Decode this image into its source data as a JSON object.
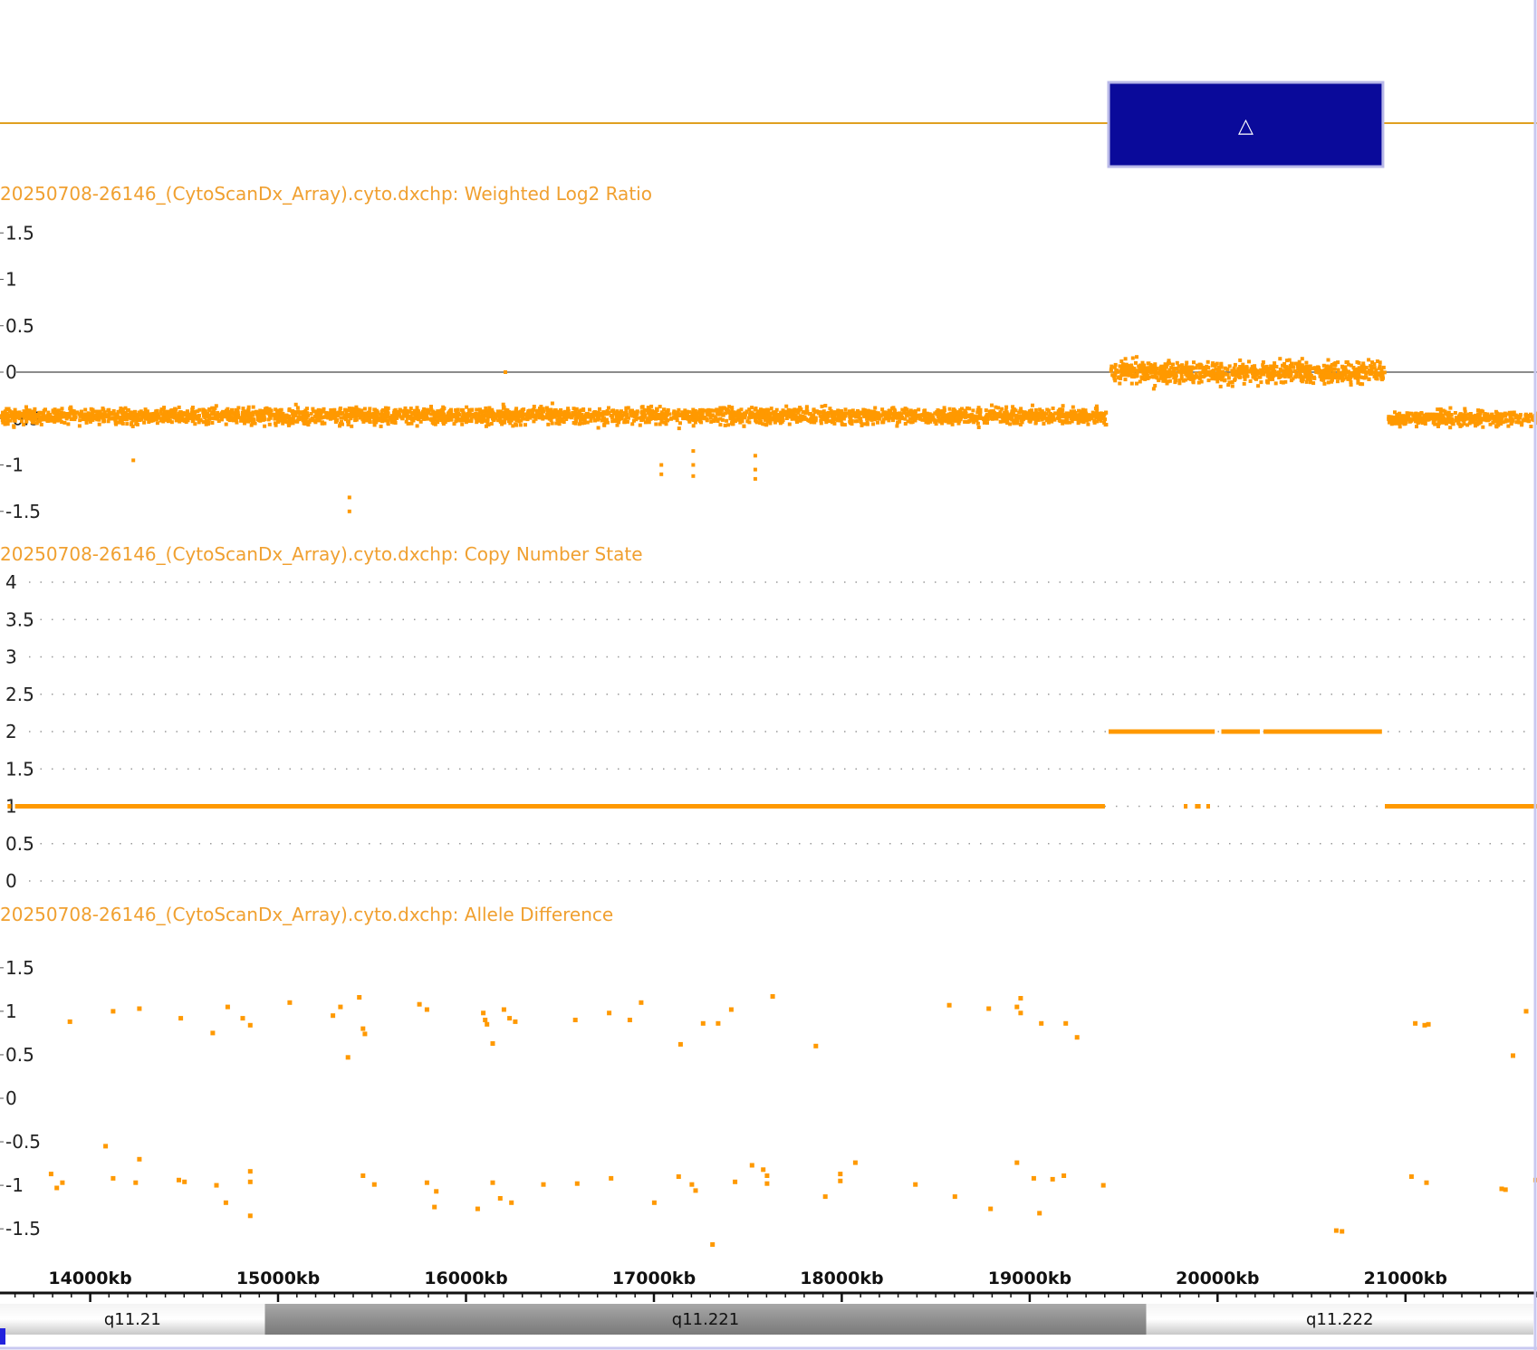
{
  "colors": {
    "data": "#ff9900",
    "title": "#f0a030",
    "segment_fill": "#0a0a9a",
    "segment_border": "#b8b8e8",
    "segment_line": "#e0a020",
    "frame": "#c8c8f0",
    "grid": "#9a9a9a",
    "zero_line": "#666666"
  },
  "segment_track": {
    "icon": "triangle-up-icon",
    "glyph": "△",
    "segment_kb": [
      19420,
      20880
    ]
  },
  "x_axis": {
    "range_kb": [
      13520,
      21700
    ],
    "tick_labels": [
      "14000kb",
      "15000kb",
      "16000kb",
      "17000kb",
      "18000kb",
      "19000kb",
      "20000kb",
      "21000kb"
    ],
    "tick_values_kb": [
      14000,
      15000,
      16000,
      17000,
      18000,
      19000,
      20000,
      21000
    ]
  },
  "cytobands": [
    {
      "name": "q11.21",
      "start_kb": 13520,
      "end_kb": 14930,
      "shade": "light"
    },
    {
      "name": "q11.221",
      "start_kb": 14930,
      "end_kb": 19620,
      "shade": "dark"
    },
    {
      "name": "q11.222",
      "start_kb": 19620,
      "end_kb": 21700,
      "shade": "light"
    }
  ],
  "chart_data": [
    {
      "type": "scatter",
      "title": "20250708-26146_(CytoScanDx_Array).cyto.dxchp: Weighted Log2 Ratio",
      "ylim": [
        -1.6,
        1.6
      ],
      "yticks": [
        "1.5",
        "1",
        "0.5",
        "0",
        "-0.5",
        "-1",
        "-1.5"
      ],
      "ytick_values": [
        1.5,
        1,
        0.5,
        0,
        -0.5,
        -1,
        -1.5
      ],
      "zero_line": true,
      "regions": [
        {
          "x_kb": [
            13520,
            19400
          ],
          "mean": -0.47,
          "spread": 0.09
        },
        {
          "x_kb": [
            19420,
            20880
          ],
          "mean": 0.0,
          "spread": 0.12
        },
        {
          "x_kb": [
            20900,
            21700
          ],
          "mean": -0.5,
          "spread": 0.08
        }
      ],
      "outliers": [
        {
          "x": 15370,
          "y": -1.35
        },
        {
          "x": 15370,
          "y": -1.5
        },
        {
          "x": 17030,
          "y": -1.0
        },
        {
          "x": 17030,
          "y": -1.1
        },
        {
          "x": 17200,
          "y": -0.85
        },
        {
          "x": 17200,
          "y": -1.0
        },
        {
          "x": 17200,
          "y": -1.12
        },
        {
          "x": 17530,
          "y": -0.9
        },
        {
          "x": 17530,
          "y": -1.05
        },
        {
          "x": 17530,
          "y": -1.15
        },
        {
          "x": 16200,
          "y": 0.0
        },
        {
          "x": 14220,
          "y": -0.95
        }
      ]
    },
    {
      "type": "line",
      "title": "20250708-26146_(CytoScanDx_Array).cyto.dxchp: Copy Number State",
      "ylim": [
        0,
        4
      ],
      "yticks": [
        "4",
        "3.5",
        "3",
        "2.5",
        "2",
        "1.5",
        "1",
        "0.5",
        "0"
      ],
      "ytick_values": [
        4,
        3.5,
        3,
        2.5,
        2,
        1.5,
        1,
        0.5,
        0
      ],
      "grid": "dotted",
      "segments": [
        {
          "x_kb": [
            13560,
            13580
          ],
          "state": 1
        },
        {
          "x_kb": [
            13600,
            19400
          ],
          "state": 1
        },
        {
          "x_kb": [
            19420,
            19985
          ],
          "state": 2
        },
        {
          "x_kb": [
            20020,
            20225
          ],
          "state": 2
        },
        {
          "x_kb": [
            20245,
            20875
          ],
          "state": 2
        },
        {
          "x_kb": [
            19820,
            19840
          ],
          "state": 1
        },
        {
          "x_kb": [
            19880,
            19910
          ],
          "state": 1
        },
        {
          "x_kb": [
            19940,
            19960
          ],
          "state": 1
        },
        {
          "x_kb": [
            20890,
            21700
          ],
          "state": 1
        }
      ]
    },
    {
      "type": "scatter",
      "title": "20250708-26146_(CytoScanDx_Array).cyto.dxchp: Allele Difference",
      "ylim": [
        -1.8,
        1.8
      ],
      "yticks": [
        "1.5",
        "1",
        "0.5",
        "0",
        "-0.5",
        "-1",
        "-1.5"
      ],
      "ytick_values": [
        1.5,
        1,
        0.5,
        0,
        -0.5,
        -1,
        -1.5
      ],
      "points": [
        [
          13880,
          0.88
        ],
        [
          14110,
          1.0
        ],
        [
          14250,
          1.03
        ],
        [
          14470,
          0.92
        ],
        [
          14640,
          0.75
        ],
        [
          14720,
          1.05
        ],
        [
          14800,
          0.92
        ],
        [
          14840,
          0.84
        ],
        [
          15050,
          1.1
        ],
        [
          15280,
          0.95
        ],
        [
          15320,
          1.05
        ],
        [
          15360,
          0.47
        ],
        [
          15420,
          1.16
        ],
        [
          15440,
          0.8
        ],
        [
          15450,
          0.74
        ],
        [
          15740,
          1.08
        ],
        [
          15780,
          1.02
        ],
        [
          16080,
          0.98
        ],
        [
          16090,
          0.9
        ],
        [
          16100,
          0.85
        ],
        [
          16130,
          0.63
        ],
        [
          16190,
          1.02
        ],
        [
          16220,
          0.92
        ],
        [
          16250,
          0.88
        ],
        [
          16570,
          0.9
        ],
        [
          16750,
          0.98
        ],
        [
          16860,
          0.9
        ],
        [
          16920,
          1.1
        ],
        [
          17130,
          0.62
        ],
        [
          17250,
          0.86
        ],
        [
          17330,
          0.86
        ],
        [
          17400,
          1.02
        ],
        [
          17620,
          1.17
        ],
        [
          17850,
          0.6
        ],
        [
          18560,
          1.07
        ],
        [
          18770,
          1.03
        ],
        [
          18920,
          1.05
        ],
        [
          18940,
          1.15
        ],
        [
          18940,
          0.98
        ],
        [
          19050,
          0.86
        ],
        [
          19180,
          0.86
        ],
        [
          19240,
          0.7
        ],
        [
          21040,
          0.86
        ],
        [
          21090,
          0.84
        ],
        [
          21110,
          0.85
        ],
        [
          21560,
          0.49
        ],
        [
          21630,
          1.0
        ],
        [
          21710,
          1.02
        ],
        [
          21710,
          1.3
        ],
        [
          13780,
          -0.87
        ],
        [
          13810,
          -1.03
        ],
        [
          13840,
          -0.97
        ],
        [
          14070,
          -0.55
        ],
        [
          14110,
          -0.92
        ],
        [
          14230,
          -0.97
        ],
        [
          14250,
          -0.7
        ],
        [
          14460,
          -0.94
        ],
        [
          14490,
          -0.96
        ],
        [
          14660,
          -1.0
        ],
        [
          14710,
          -1.2
        ],
        [
          14840,
          -0.84
        ],
        [
          14840,
          -0.96
        ],
        [
          14840,
          -1.35
        ],
        [
          15440,
          -0.89
        ],
        [
          15500,
          -0.99
        ],
        [
          15780,
          -0.97
        ],
        [
          15820,
          -1.25
        ],
        [
          15830,
          -1.07
        ],
        [
          16050,
          -1.27
        ],
        [
          16130,
          -0.97
        ],
        [
          16170,
          -1.15
        ],
        [
          16230,
          -1.2
        ],
        [
          16400,
          -0.99
        ],
        [
          16580,
          -0.98
        ],
        [
          16760,
          -0.92
        ],
        [
          16990,
          -1.2
        ],
        [
          17120,
          -0.9
        ],
        [
          17190,
          -0.99
        ],
        [
          17210,
          -1.06
        ],
        [
          17300,
          -1.68
        ],
        [
          17420,
          -0.96
        ],
        [
          17510,
          -0.77
        ],
        [
          17570,
          -0.82
        ],
        [
          17590,
          -0.89
        ],
        [
          17590,
          -0.98
        ],
        [
          17900,
          -1.13
        ],
        [
          17980,
          -0.87
        ],
        [
          17980,
          -0.95
        ],
        [
          18060,
          -0.74
        ],
        [
          18380,
          -0.99
        ],
        [
          18590,
          -1.13
        ],
        [
          18780,
          -1.27
        ],
        [
          18920,
          -0.74
        ],
        [
          19010,
          -0.92
        ],
        [
          19040,
          -1.32
        ],
        [
          19110,
          -0.93
        ],
        [
          19170,
          -0.89
        ],
        [
          19380,
          -1.0
        ],
        [
          20620,
          -1.52
        ],
        [
          20650,
          -1.53
        ],
        [
          21020,
          -0.9
        ],
        [
          21100,
          -0.97
        ],
        [
          21500,
          -1.04
        ],
        [
          21520,
          -1.05
        ],
        [
          21680,
          -0.94
        ],
        [
          21700,
          -0.9
        ]
      ]
    }
  ]
}
